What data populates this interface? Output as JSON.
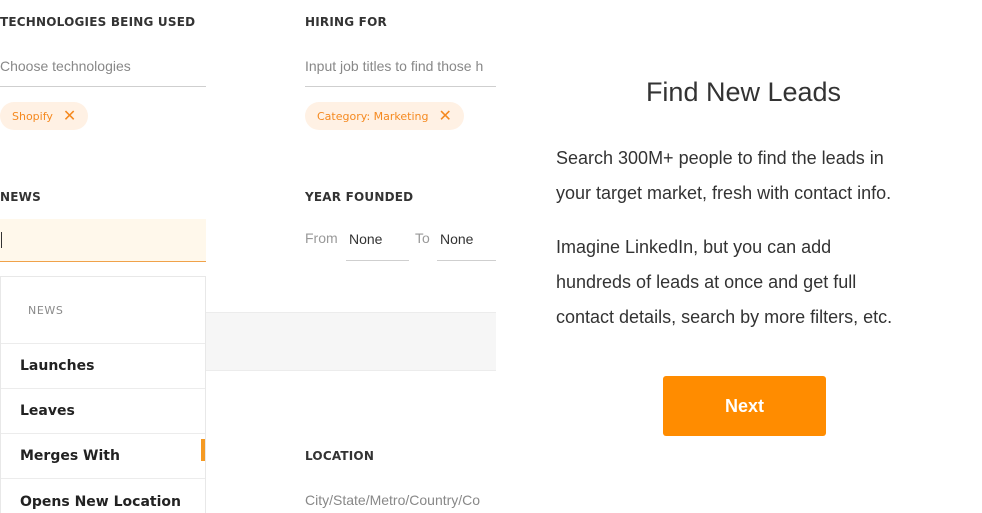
{
  "technologies": {
    "label": "TECHNOLOGIES BEING USED",
    "placeholder": "Choose technologies",
    "chips": [
      {
        "label": "Shopify",
        "remove": "✕"
      }
    ]
  },
  "hiring": {
    "label": "HIRING FOR",
    "placeholder": "Input job titles to find those h",
    "chips": [
      {
        "label": "Category: Marketing",
        "remove": "✕"
      }
    ]
  },
  "news": {
    "label": "NEWS",
    "value": "",
    "dropdown": {
      "header": "NEWS",
      "items": [
        "Launches",
        "Leaves",
        "Merges With",
        "Opens New Location"
      ]
    }
  },
  "year_founded": {
    "label": "YEAR FOUNDED",
    "from_label": "From",
    "from_value": "None",
    "to_label": "To",
    "to_value": "None"
  },
  "location": {
    "label": "LOCATION",
    "placeholder": "City/State/Metro/Country/Co"
  },
  "panel": {
    "title": "Find New Leads",
    "paragraph1": [
      "Search 300M+ people to find the leads in",
      "your target market, fresh with contact info."
    ],
    "paragraph2": [
      "Imagine LinkedIn, but you can add",
      "hundreds of leads at once and get full",
      "contact details, search by more filters, etc."
    ],
    "next_label": "Next"
  },
  "colors": {
    "accent": "#ff8c00",
    "chip_bg": "#fff1e4",
    "chip_text": "#f5891f"
  }
}
